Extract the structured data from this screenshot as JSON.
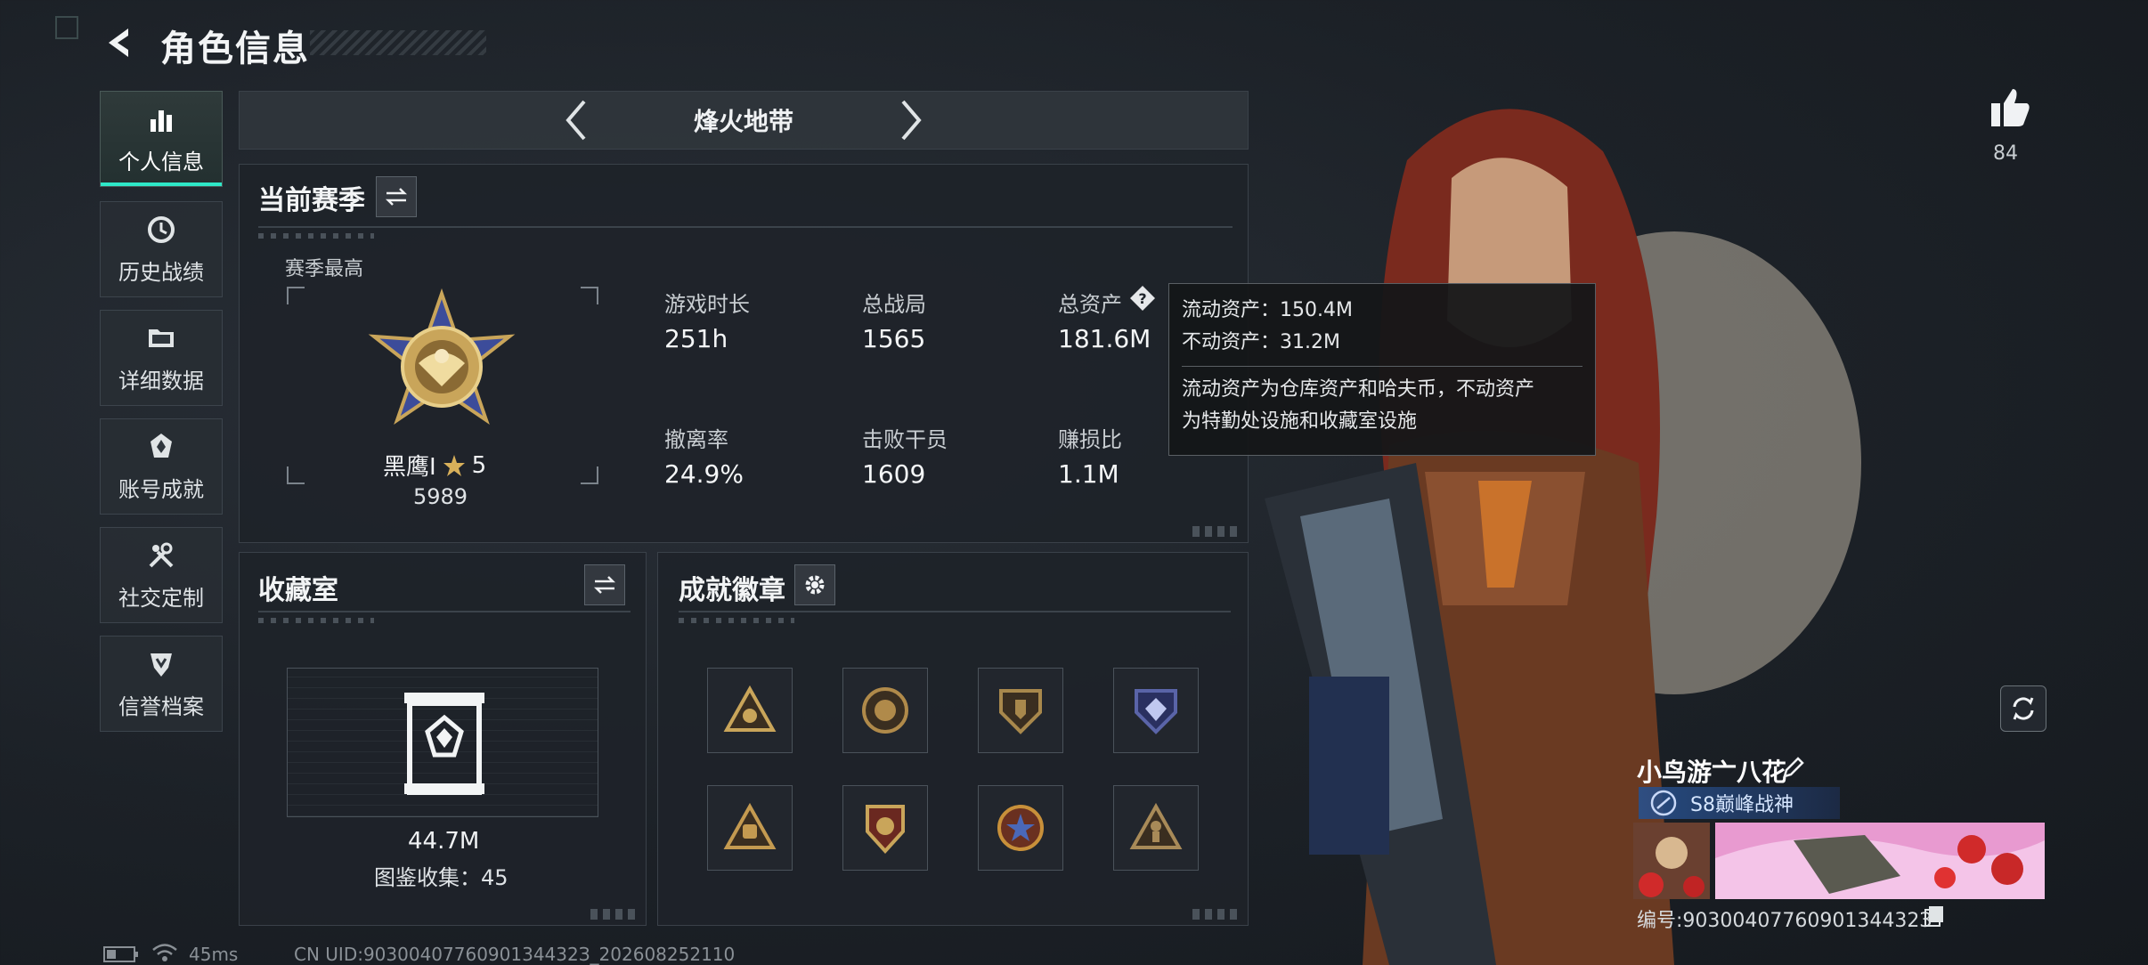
{
  "header": {
    "title": "角色信息"
  },
  "sidebar": {
    "items": [
      {
        "label": "个人信息",
        "icon": "bar-chart-icon",
        "active": true
      },
      {
        "label": "历史战绩",
        "icon": "clock-history-icon"
      },
      {
        "label": "详细数据",
        "icon": "folder-icon"
      },
      {
        "label": "账号成就",
        "icon": "achievement-icon"
      },
      {
        "label": "社交定制",
        "icon": "tools-icon"
      },
      {
        "label": "信誉档案",
        "icon": "credit-shield-icon"
      }
    ]
  },
  "mode_nav": {
    "title": "烽火地带"
  },
  "season": {
    "title": "当前赛季",
    "best_label": "赛季最高",
    "rank_name": "黑鹰I",
    "rank_stars": "5",
    "rank_score": "5989",
    "stats": [
      {
        "label": "游戏时长",
        "value": "251h"
      },
      {
        "label": "总战局",
        "value": "1565"
      },
      {
        "label": "总资产",
        "value": "181.6M"
      },
      {
        "label": "撤离率",
        "value": "24.9%"
      },
      {
        "label": "击败干员",
        "value": "1609"
      },
      {
        "label": "赚损比",
        "value": "1.1M"
      }
    ]
  },
  "tooltip": {
    "liquid": "流动资产：150.4M",
    "fixed": "不动资产：31.2M",
    "desc_line1": "流动资产为仓库资产和哈夫币，不动资产",
    "desc_line2": "为特勤处设施和收藏室设施"
  },
  "collection": {
    "title": "收藏室",
    "value": "44.7M",
    "count": "图鉴收集：45"
  },
  "badges": {
    "title": "成就徽章",
    "colors": [
      "#c9a55a",
      "#b08a4a",
      "#a8884c",
      "#5a64a8",
      "#c49a50",
      "#b84a3a",
      "#c8903a",
      "#a88a58"
    ]
  },
  "social": {
    "likes": "84",
    "player_name": "小鸟游亠八花",
    "title_badge": "S8巅峰战神",
    "uid": "编号:9030040776090134432З"
  },
  "footer": {
    "ping": "45ms",
    "cn_uid": "CN UID:9030040776090134432З_202608252110"
  },
  "colors": {
    "accent": "#2ee8c8",
    "panel": "#1e2329"
  }
}
